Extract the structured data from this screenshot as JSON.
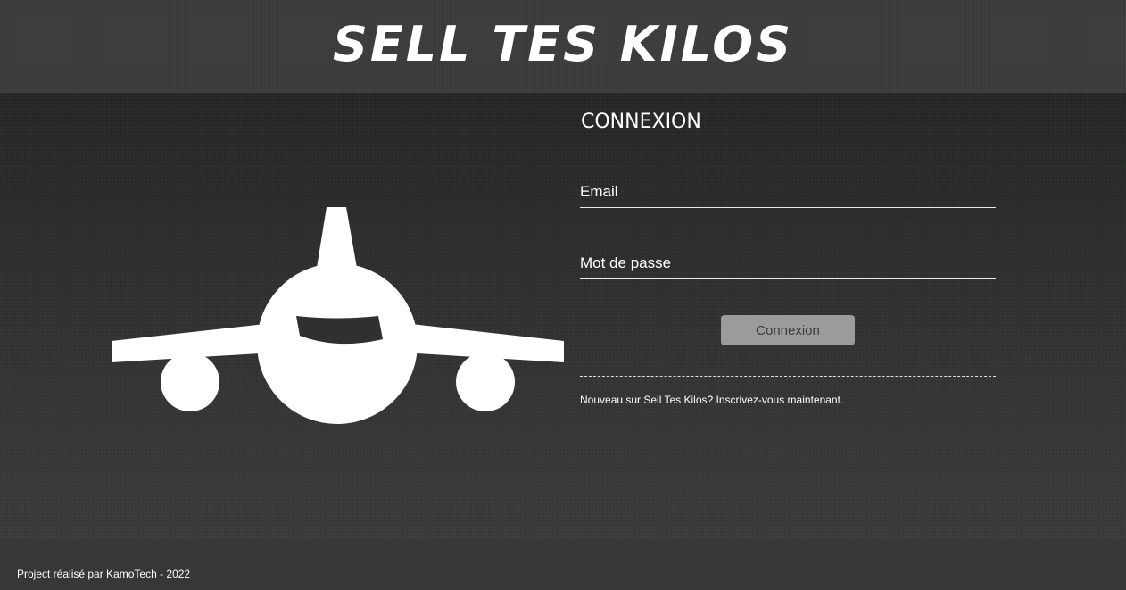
{
  "header": {
    "brand": "SELL TES KILOS"
  },
  "login": {
    "title": "CONNEXION",
    "email_placeholder": "Email",
    "password_placeholder": "Mot de passe",
    "submit_label": "Connexion",
    "signup_prefix": "Nouveau sur Sell Tes Kilos? ",
    "signup_link": "Inscrivez-vous maintenant."
  },
  "hero": {
    "icon": "airplane-icon"
  },
  "footer": {
    "credit": "Project réalisé par KamoTech - 2022"
  },
  "colors": {
    "header_bg": "#3a3a3a",
    "main_bg": "#2b2c2b",
    "footer_bg": "#373737",
    "button_bg": "#9b9b9b",
    "button_text": "#3c3c3c",
    "text": "#ffffff"
  }
}
